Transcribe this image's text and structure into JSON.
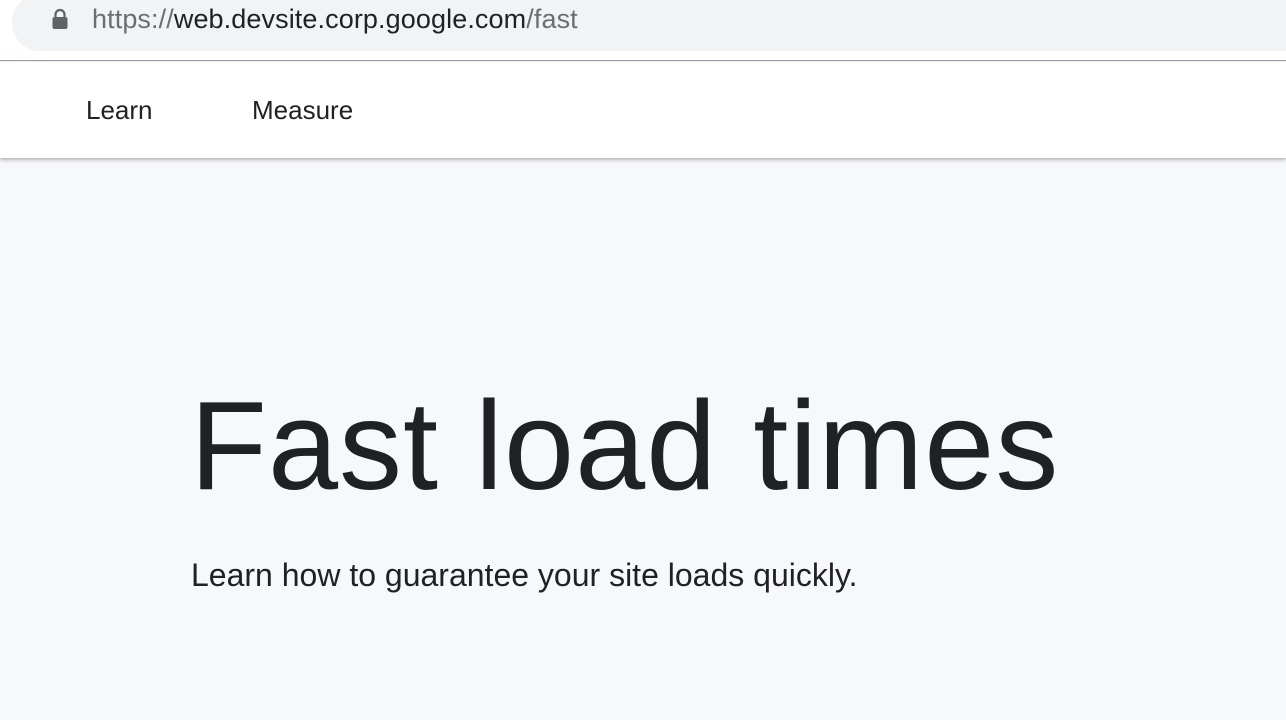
{
  "browser": {
    "url_scheme": "https://",
    "url_host": "web.devsite.corp.google.com",
    "url_path": "/fast",
    "lock_icon": "lock-icon"
  },
  "nav": {
    "items": [
      {
        "label": "Learn"
      },
      {
        "label": "Measure"
      }
    ]
  },
  "hero": {
    "title": "Fast load times",
    "subtitle": "Learn how to guarantee your site loads quickly."
  },
  "colors": {
    "page_background": "#f7f8fa",
    "omnibox_background": "#f1f3f4",
    "text_primary": "#202124",
    "text_secondary": "#6b6f73"
  }
}
